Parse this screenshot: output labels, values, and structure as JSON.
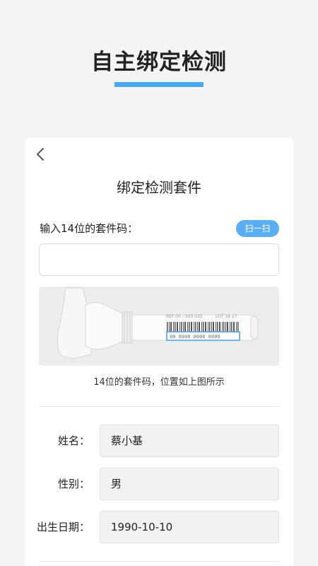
{
  "header": {
    "title": "自主绑定检测",
    "accent_color": "#4aa8f0"
  },
  "card": {
    "back_icon": "chevron-left-icon",
    "title": "绑定检测套件",
    "code_label": "输入14位的套件码：",
    "scan_button_label": "扫一扫",
    "code_input_value": "",
    "code_input_placeholder": "",
    "kit_image": {
      "description_icon": "test-kit-barcode-image",
      "barcode_text": "00 0000 0000 0000",
      "label_left": "REF 00 - 500 035",
      "label_right": "LOT 16 27"
    },
    "hint": "14位的套件码，位置如上图所示"
  },
  "form": {
    "name_label": "姓名：",
    "name_value": "蔡小基",
    "gender_label": "性别：",
    "gender_value": "男",
    "birth_label": "出生日期：",
    "birth_value": "1990-10-10"
  }
}
